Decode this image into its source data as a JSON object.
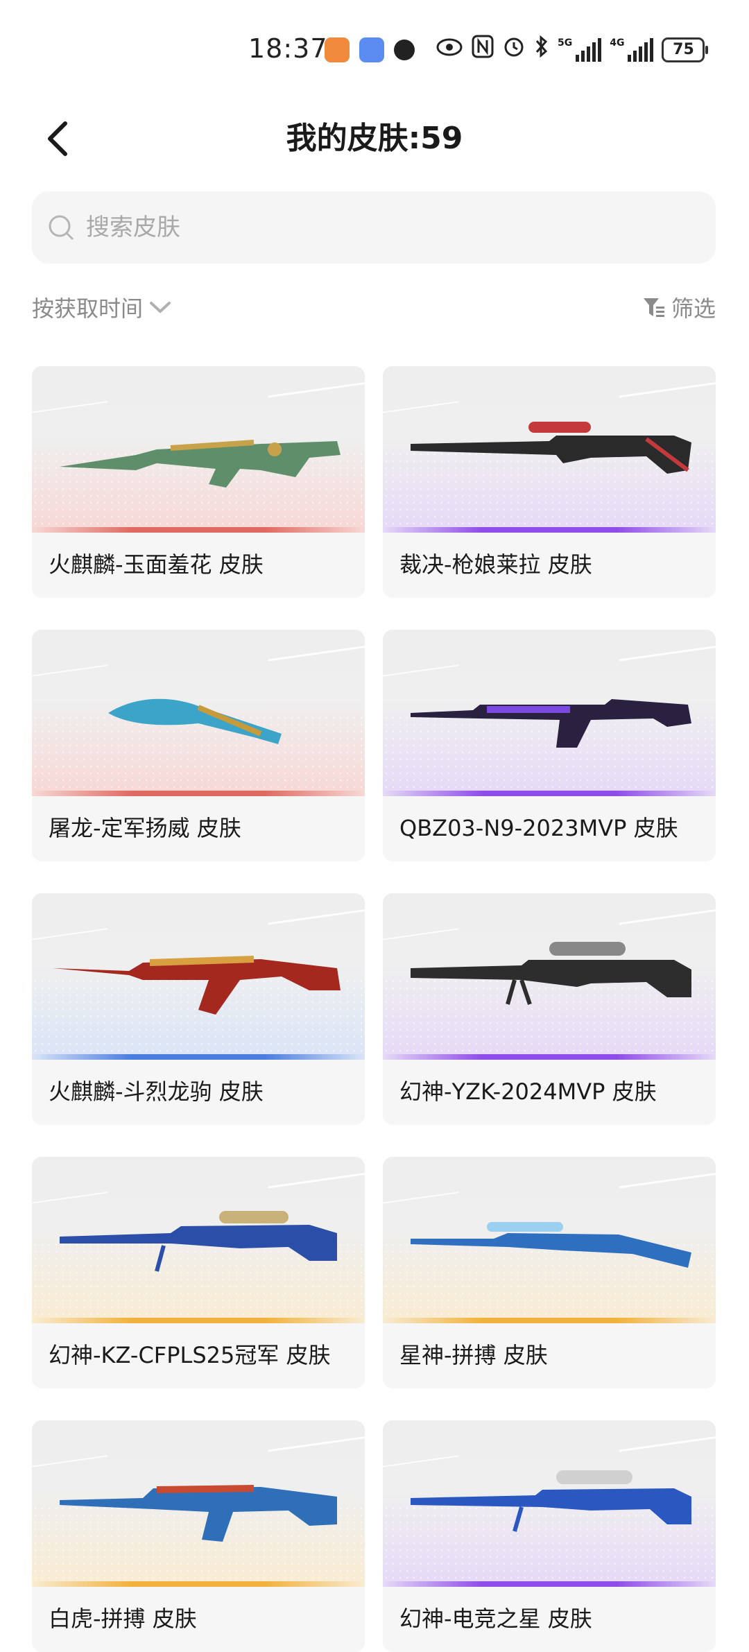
{
  "status_bar": {
    "time": "18:37",
    "network_1": "5G",
    "network_2": "4G",
    "battery": "75"
  },
  "header": {
    "title": "我的皮肤:59"
  },
  "search": {
    "placeholder": "搜索皮肤",
    "value": ""
  },
  "sort": {
    "label": "按获取时间"
  },
  "filter": {
    "label": "筛选"
  },
  "skins": [
    {
      "name": "火麒麟-玉面羞花 皮肤",
      "rarity_color": "#e06a62",
      "glow": "#f7d9d6"
    },
    {
      "name": "裁决-枪娘莱拉 皮肤",
      "rarity_color": "#8e4ce8",
      "glow": "#e6daf7"
    },
    {
      "name": "屠龙-定军扬威 皮肤",
      "rarity_color": "#e06a62",
      "glow": "#f7d9d6"
    },
    {
      "name": "QBZ03-N9-2023MVP 皮肤",
      "rarity_color": "#8e4ce8",
      "glow": "#e6daf7"
    },
    {
      "name": "火麒麟-斗烈龙驹 皮肤",
      "rarity_color": "#4a7de0",
      "glow": "#dbe5f7"
    },
    {
      "name": "幻神-YZK-2024MVP 皮肤",
      "rarity_color": "#8e4ce8",
      "glow": "#e6daf7"
    },
    {
      "name": "幻神-KZ-CFPLS25冠军 皮肤",
      "rarity_color": "#f2b13c",
      "glow": "#f8ecd3"
    },
    {
      "name": "星神-拼搏 皮肤",
      "rarity_color": "#f2b13c",
      "glow": "#f8ecd3"
    },
    {
      "name": "白虎-拼搏 皮肤",
      "rarity_color": "#f2b13c",
      "glow": "#f8ecd3"
    },
    {
      "name": "幻神-电竞之星 皮肤",
      "rarity_color": "#8e4ce8",
      "glow": "#e6daf7"
    }
  ],
  "icons": {
    "back": "chevron-left-icon",
    "search": "search-icon",
    "sort": "chevron-down-icon",
    "filter": "filter-icon"
  }
}
